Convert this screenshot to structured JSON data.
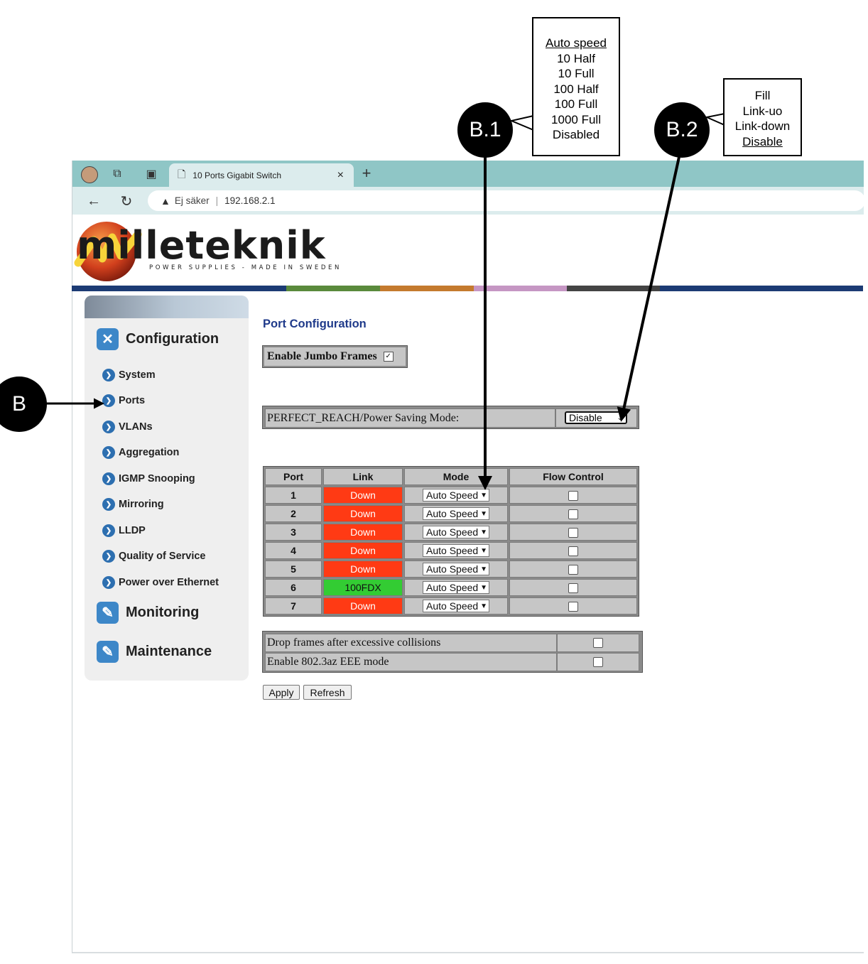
{
  "annotations": {
    "b1_label": "B.1",
    "b2_label": "B.2",
    "b_label": "B",
    "b1_options": [
      "Auto speed",
      "10 Half",
      "10 Full",
      "100 Half",
      "100 Full",
      "1000 Full",
      "Disabled"
    ],
    "b2_options": [
      "Fill",
      "Link-uo",
      "Link-down",
      "Disable"
    ]
  },
  "browser": {
    "tab_title": "10 Ports Gigabit Switch",
    "security_label": "Ej säker",
    "url": "192.168.2.1"
  },
  "logo": {
    "brand": "milleteknik",
    "tagline": "POWER SUPPLIES - MADE IN SWEDEN"
  },
  "sidebar": {
    "configuration": "Configuration",
    "items": [
      "System",
      "Ports",
      "VLANs",
      "Aggregation",
      "IGMP Snooping",
      "Mirroring",
      "LLDP",
      "Quality of Service",
      "Power over Ethernet"
    ],
    "monitoring": "Monitoring",
    "maintenance": "Maintenance"
  },
  "main": {
    "title": "Port Configuration",
    "jumbo_label": "Enable Jumbo Frames",
    "perfect_reach_label": "PERFECT_REACH/Power Saving Mode:",
    "perfect_reach_value": "Disable",
    "table": {
      "headers": [
        "Port",
        "Link",
        "Mode",
        "Flow Control"
      ],
      "rows": [
        {
          "port": "1",
          "link": "Down",
          "mode": "Auto Speed"
        },
        {
          "port": "2",
          "link": "Down",
          "mode": "Auto Speed"
        },
        {
          "port": "3",
          "link": "Down",
          "mode": "Auto Speed"
        },
        {
          "port": "4",
          "link": "Down",
          "mode": "Auto Speed"
        },
        {
          "port": "5",
          "link": "Down",
          "mode": "Auto Speed"
        },
        {
          "port": "6",
          "link": "100FDX",
          "mode": "Auto Speed"
        },
        {
          "port": "7",
          "link": "Down",
          "mode": "Auto Speed"
        }
      ]
    },
    "drop_frames_label": "Drop frames after excessive collisions",
    "eee_label": "Enable 802.3az EEE mode",
    "apply": "Apply",
    "refresh": "Refresh"
  },
  "colors": {
    "link_down": "#ff3a14",
    "link_up": "#33cc33",
    "nav_blue": "#2d6fb0",
    "title_blue": "#1f3a8a"
  }
}
